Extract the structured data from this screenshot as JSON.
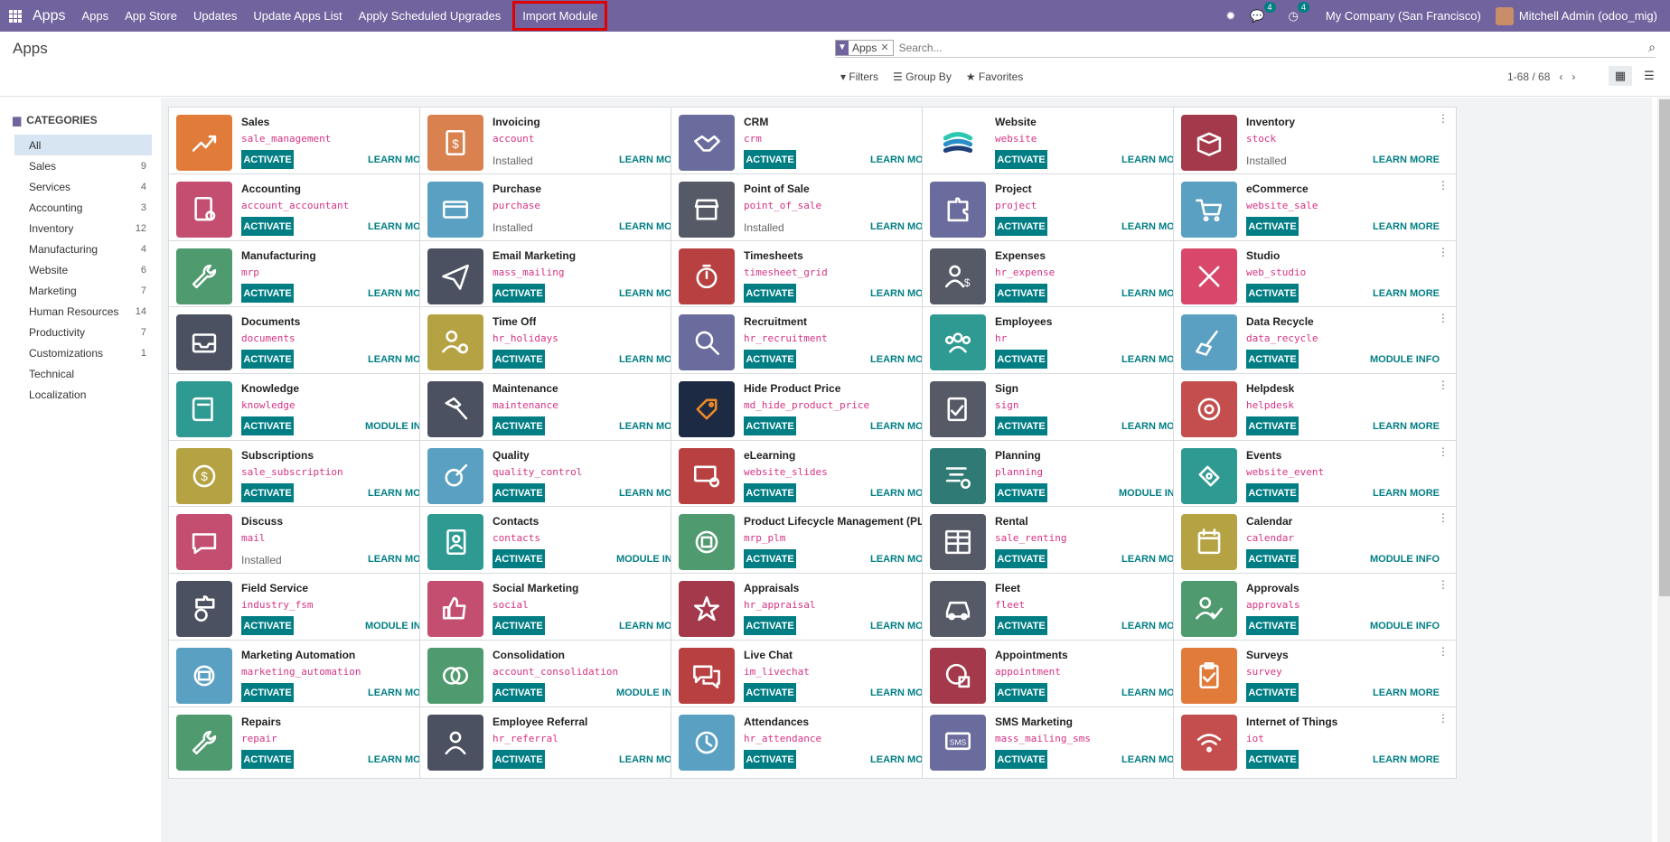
{
  "navbar": {
    "brand": "Apps",
    "items": [
      "Apps",
      "App Store",
      "Updates",
      "Update Apps List",
      "Apply Scheduled Upgrades",
      "Import Module"
    ],
    "highlighted": "Import Module",
    "messages_count": "4",
    "activities_count": "4",
    "company": "My Company (San Francisco)",
    "user": "Mitchell Admin (odoo_mig)"
  },
  "control_panel": {
    "title": "Apps",
    "facet_label": "Apps",
    "search_placeholder": "Search...",
    "filters_label": "Filters",
    "groupby_label": "Group By",
    "favorites_label": "Favorites",
    "pager": "1-68 / 68"
  },
  "sidebar": {
    "header": "CATEGORIES",
    "items": [
      {
        "label": "All",
        "count": ""
      },
      {
        "label": "Sales",
        "count": "9"
      },
      {
        "label": "Services",
        "count": "4"
      },
      {
        "label": "Accounting",
        "count": "3"
      },
      {
        "label": "Inventory",
        "count": "12"
      },
      {
        "label": "Manufacturing",
        "count": "4"
      },
      {
        "label": "Website",
        "count": "6"
      },
      {
        "label": "Marketing",
        "count": "7"
      },
      {
        "label": "Human Resources",
        "count": "14"
      },
      {
        "label": "Productivity",
        "count": "7"
      },
      {
        "label": "Customizations",
        "count": "1"
      },
      {
        "label": "Technical",
        "count": ""
      },
      {
        "label": "Localization",
        "count": ""
      }
    ]
  },
  "labels": {
    "activate": "ACTIVATE",
    "installed": "Installed"
  },
  "apps": [
    {
      "name": "Sales",
      "tech": "sale_management",
      "state": "activate",
      "link": "LEARN MORE",
      "color": "#e07b39",
      "icon": "chart-icon"
    },
    {
      "name": "Invoicing",
      "tech": "account",
      "state": "installed",
      "link": "LEARN MORE",
      "color": "#d9814f",
      "icon": "invoice-icon"
    },
    {
      "name": "CRM",
      "tech": "crm",
      "state": "activate",
      "link": "LEARN MORE",
      "color": "#6a6c9e",
      "icon": "handshake-icon"
    },
    {
      "name": "Website",
      "tech": "website",
      "state": "activate",
      "link": "LEARN MORE",
      "color": "#ffffff",
      "icon": "website-icon"
    },
    {
      "name": "Inventory",
      "tech": "stock",
      "state": "installed",
      "link": "LEARN MORE",
      "color": "#a3394a",
      "icon": "box-icon"
    },
    {
      "name": "Accounting",
      "tech": "account_accountant",
      "state": "activate",
      "link": "LEARN MORE",
      "color": "#c44e6f",
      "icon": "document-gear-icon"
    },
    {
      "name": "Purchase",
      "tech": "purchase",
      "state": "installed",
      "link": "LEARN MORE",
      "color": "#5aa0c2",
      "icon": "card-icon"
    },
    {
      "name": "Point of Sale",
      "tech": "point_of_sale",
      "state": "installed",
      "link": "LEARN MORE",
      "color": "#555a66",
      "icon": "store-icon"
    },
    {
      "name": "Project",
      "tech": "project",
      "state": "activate",
      "link": "LEARN MORE",
      "color": "#6a6c9e",
      "icon": "puzzle-icon"
    },
    {
      "name": "eCommerce",
      "tech": "website_sale",
      "state": "activate",
      "link": "LEARN MORE",
      "color": "#5aa0c2",
      "icon": "cart-icon"
    },
    {
      "name": "Manufacturing",
      "tech": "mrp",
      "state": "activate",
      "link": "LEARN MORE",
      "color": "#4f9a6e",
      "icon": "wrench-icon"
    },
    {
      "name": "Email Marketing",
      "tech": "mass_mailing",
      "state": "activate",
      "link": "LEARN MORE",
      "color": "#4b5160",
      "icon": "paper-plane-icon"
    },
    {
      "name": "Timesheets",
      "tech": "timesheet_grid",
      "state": "activate",
      "link": "LEARN MORE",
      "color": "#b84040",
      "icon": "stopwatch-icon"
    },
    {
      "name": "Expenses",
      "tech": "hr_expense",
      "state": "activate",
      "link": "LEARN MORE",
      "color": "#555a66",
      "icon": "user-dollar-icon"
    },
    {
      "name": "Studio",
      "tech": "web_studio",
      "state": "activate",
      "link": "LEARN MORE",
      "color": "#d9486a",
      "icon": "tools-icon"
    },
    {
      "name": "Documents",
      "tech": "documents",
      "state": "activate",
      "link": "LEARN MORE",
      "color": "#4b5160",
      "icon": "inbox-icon"
    },
    {
      "name": "Time Off",
      "tech": "hr_holidays",
      "state": "activate",
      "link": "LEARN MORE",
      "color": "#b5a343",
      "icon": "user-gear-icon"
    },
    {
      "name": "Recruitment",
      "tech": "hr_recruitment",
      "state": "activate",
      "link": "LEARN MORE",
      "color": "#6a6c9e",
      "icon": "magnifier-icon"
    },
    {
      "name": "Employees",
      "tech": "hr",
      "state": "activate",
      "link": "LEARN MORE",
      "color": "#2f9a92",
      "icon": "users-icon"
    },
    {
      "name": "Data Recycle",
      "tech": "data_recycle",
      "state": "activate",
      "link": "MODULE INFO",
      "color": "#5aa0c2",
      "icon": "broom-icon"
    },
    {
      "name": "Knowledge",
      "tech": "knowledge",
      "state": "activate",
      "link": "MODULE INFO",
      "color": "#2f9a92",
      "icon": "book-icon"
    },
    {
      "name": "Maintenance",
      "tech": "maintenance",
      "state": "activate",
      "link": "LEARN MORE",
      "color": "#4b5160",
      "icon": "hammer-icon"
    },
    {
      "name": "Hide Product Price",
      "tech": "md_hide_product_price",
      "state": "activate",
      "link": "LEARN MORE",
      "color": "#1c2a44",
      "icon": "price-tag-icon"
    },
    {
      "name": "Sign",
      "tech": "sign",
      "state": "activate",
      "link": "LEARN MORE",
      "color": "#555a66",
      "icon": "sign-icon"
    },
    {
      "name": "Helpdesk",
      "tech": "helpdesk",
      "state": "activate",
      "link": "LEARN MORE",
      "color": "#c44e4e",
      "icon": "lifebuoy-icon"
    },
    {
      "name": "Subscriptions",
      "tech": "sale_subscription",
      "state": "activate",
      "link": "LEARN MORE",
      "color": "#b5a343",
      "icon": "recurring-dollar-icon"
    },
    {
      "name": "Quality",
      "tech": "quality_control",
      "state": "activate",
      "link": "LEARN MORE",
      "color": "#5aa0c2",
      "icon": "gear-check-icon"
    },
    {
      "name": "eLearning",
      "tech": "website_slides",
      "state": "activate",
      "link": "LEARN MORE",
      "color": "#b84040",
      "icon": "presentation-icon"
    },
    {
      "name": "Planning",
      "tech": "planning",
      "state": "activate",
      "link": "MODULE INFO",
      "color": "#2f7a74",
      "icon": "planning-icon"
    },
    {
      "name": "Events",
      "tech": "website_event",
      "state": "activate",
      "link": "LEARN MORE",
      "color": "#2f9a92",
      "icon": "ticket-icon"
    },
    {
      "name": "Discuss",
      "tech": "mail",
      "state": "installed",
      "link": "LEARN MORE",
      "color": "#c44e6f",
      "icon": "chat-bubble-icon"
    },
    {
      "name": "Contacts",
      "tech": "contacts",
      "state": "activate",
      "link": "MODULE INFO",
      "color": "#2f9a92",
      "icon": "address-book-icon"
    },
    {
      "name": "Product Lifecycle Management (PL...",
      "tech": "mrp_plm",
      "state": "activate",
      "link": "LEARN MORE",
      "color": "#4f9a6e",
      "icon": "cycle-box-icon"
    },
    {
      "name": "Rental",
      "tech": "sale_renting",
      "state": "activate",
      "link": "LEARN MORE",
      "color": "#555a66",
      "icon": "calendar-grid-icon"
    },
    {
      "name": "Calendar",
      "tech": "calendar",
      "state": "activate",
      "link": "MODULE INFO",
      "color": "#b5a343",
      "icon": "calendar-icon"
    },
    {
      "name": "Field Service",
      "tech": "industry_fsm",
      "state": "activate",
      "link": "MODULE INFO",
      "color": "#4b5160",
      "icon": "puzzle-timer-icon"
    },
    {
      "name": "Social Marketing",
      "tech": "social",
      "state": "activate",
      "link": "LEARN MORE",
      "color": "#c44e6f",
      "icon": "thumbs-up-icon"
    },
    {
      "name": "Appraisals",
      "tech": "hr_appraisal",
      "state": "activate",
      "link": "LEARN MORE",
      "color": "#a3394a",
      "icon": "star-icon"
    },
    {
      "name": "Fleet",
      "tech": "fleet",
      "state": "activate",
      "link": "LEARN MORE",
      "color": "#555a66",
      "icon": "car-icon"
    },
    {
      "name": "Approvals",
      "tech": "approvals",
      "state": "activate",
      "link": "MODULE INFO",
      "color": "#4f9a6e",
      "icon": "user-check-icon"
    },
    {
      "name": "Marketing Automation",
      "tech": "marketing_automation",
      "state": "activate",
      "link": "LEARN MORE",
      "color": "#5aa0c2",
      "icon": "gear-mail-icon"
    },
    {
      "name": "Consolidation",
      "tech": "account_consolidation",
      "state": "activate",
      "link": "MODULE INFO",
      "color": "#4f9a6e",
      "icon": "circles-icon"
    },
    {
      "name": "Live Chat",
      "tech": "im_livechat",
      "state": "activate",
      "link": "LEARN MORE",
      "color": "#b84040",
      "icon": "chat-bubbles-icon"
    },
    {
      "name": "Appointments",
      "tech": "appointment",
      "state": "activate",
      "link": "LEARN MORE",
      "color": "#a3394a",
      "icon": "globe-calendar-icon"
    },
    {
      "name": "Surveys",
      "tech": "survey",
      "state": "activate",
      "link": "LEARN MORE",
      "color": "#e07b39",
      "icon": "clipboard-icon"
    },
    {
      "name": "Repairs",
      "tech": "repair",
      "state": "activate",
      "link": "LEARN MORE",
      "color": "#4f9a6e",
      "icon": "wrench-icon"
    },
    {
      "name": "Employee Referral",
      "tech": "hr_referral",
      "state": "activate",
      "link": "LEARN MORE",
      "color": "#4b5160",
      "icon": "user-icon"
    },
    {
      "name": "Attendances",
      "tech": "hr_attendance",
      "state": "activate",
      "link": "LEARN MORE",
      "color": "#5aa0c2",
      "icon": "clock-icon"
    },
    {
      "name": "SMS Marketing",
      "tech": "mass_mailing_sms",
      "state": "activate",
      "link": "LEARN MORE",
      "color": "#6a6c9e",
      "icon": "sms-icon"
    },
    {
      "name": "Internet of Things",
      "tech": "iot",
      "state": "activate",
      "link": "LEARN MORE",
      "color": "#c44e4e",
      "icon": "wifi-icon"
    }
  ]
}
